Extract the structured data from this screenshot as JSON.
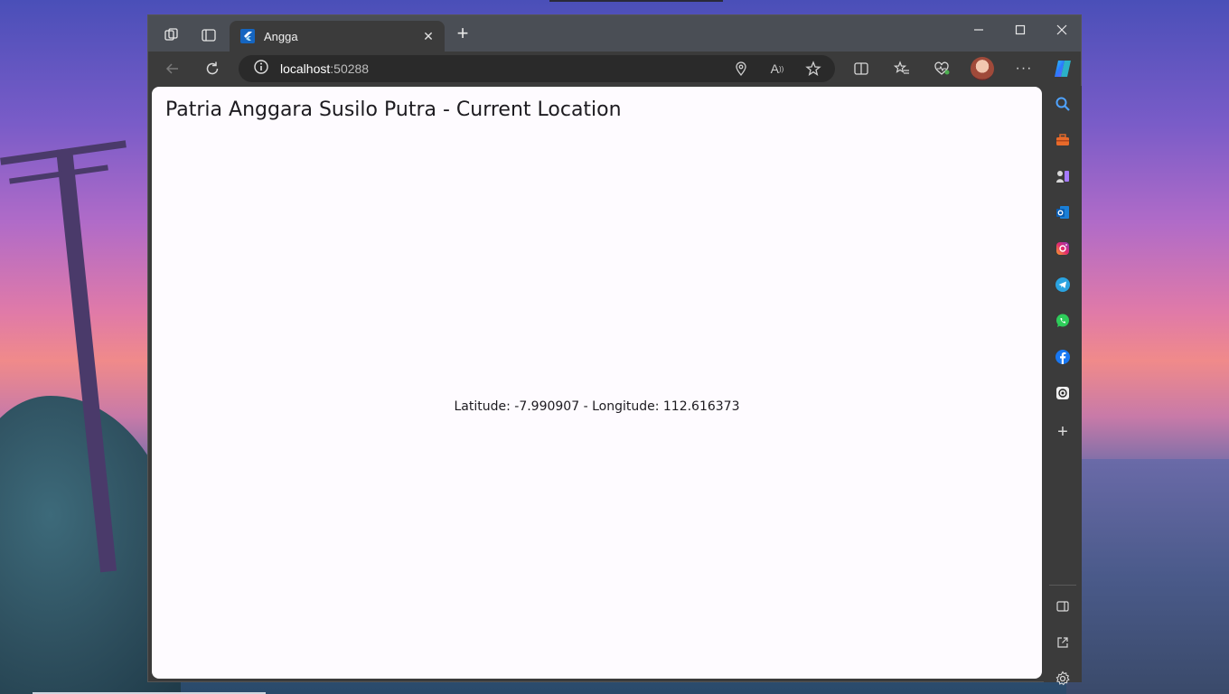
{
  "browser": {
    "tab": {
      "title": "Angga"
    },
    "address": {
      "host": "localhost",
      "port": ":50288"
    }
  },
  "page": {
    "title": "Patria Anggara Susilo Putra - Current Location",
    "coordinates": "Latitude: -7.990907 - Longitude: 112.616373"
  },
  "sidebar": {
    "items": [
      "search-icon",
      "tools-icon",
      "games-icon",
      "outlook-icon",
      "instagram-icon",
      "telegram-icon",
      "whatsapp-icon",
      "facebook-icon",
      "chatgpt-icon",
      "add-icon"
    ],
    "bottom": [
      "sidebar-toggle-icon",
      "external-link-icon",
      "settings-icon"
    ]
  },
  "colors": {
    "accent": "#1565c0",
    "content_bg": "#fefbff",
    "chrome": "#3b3b3b"
  }
}
